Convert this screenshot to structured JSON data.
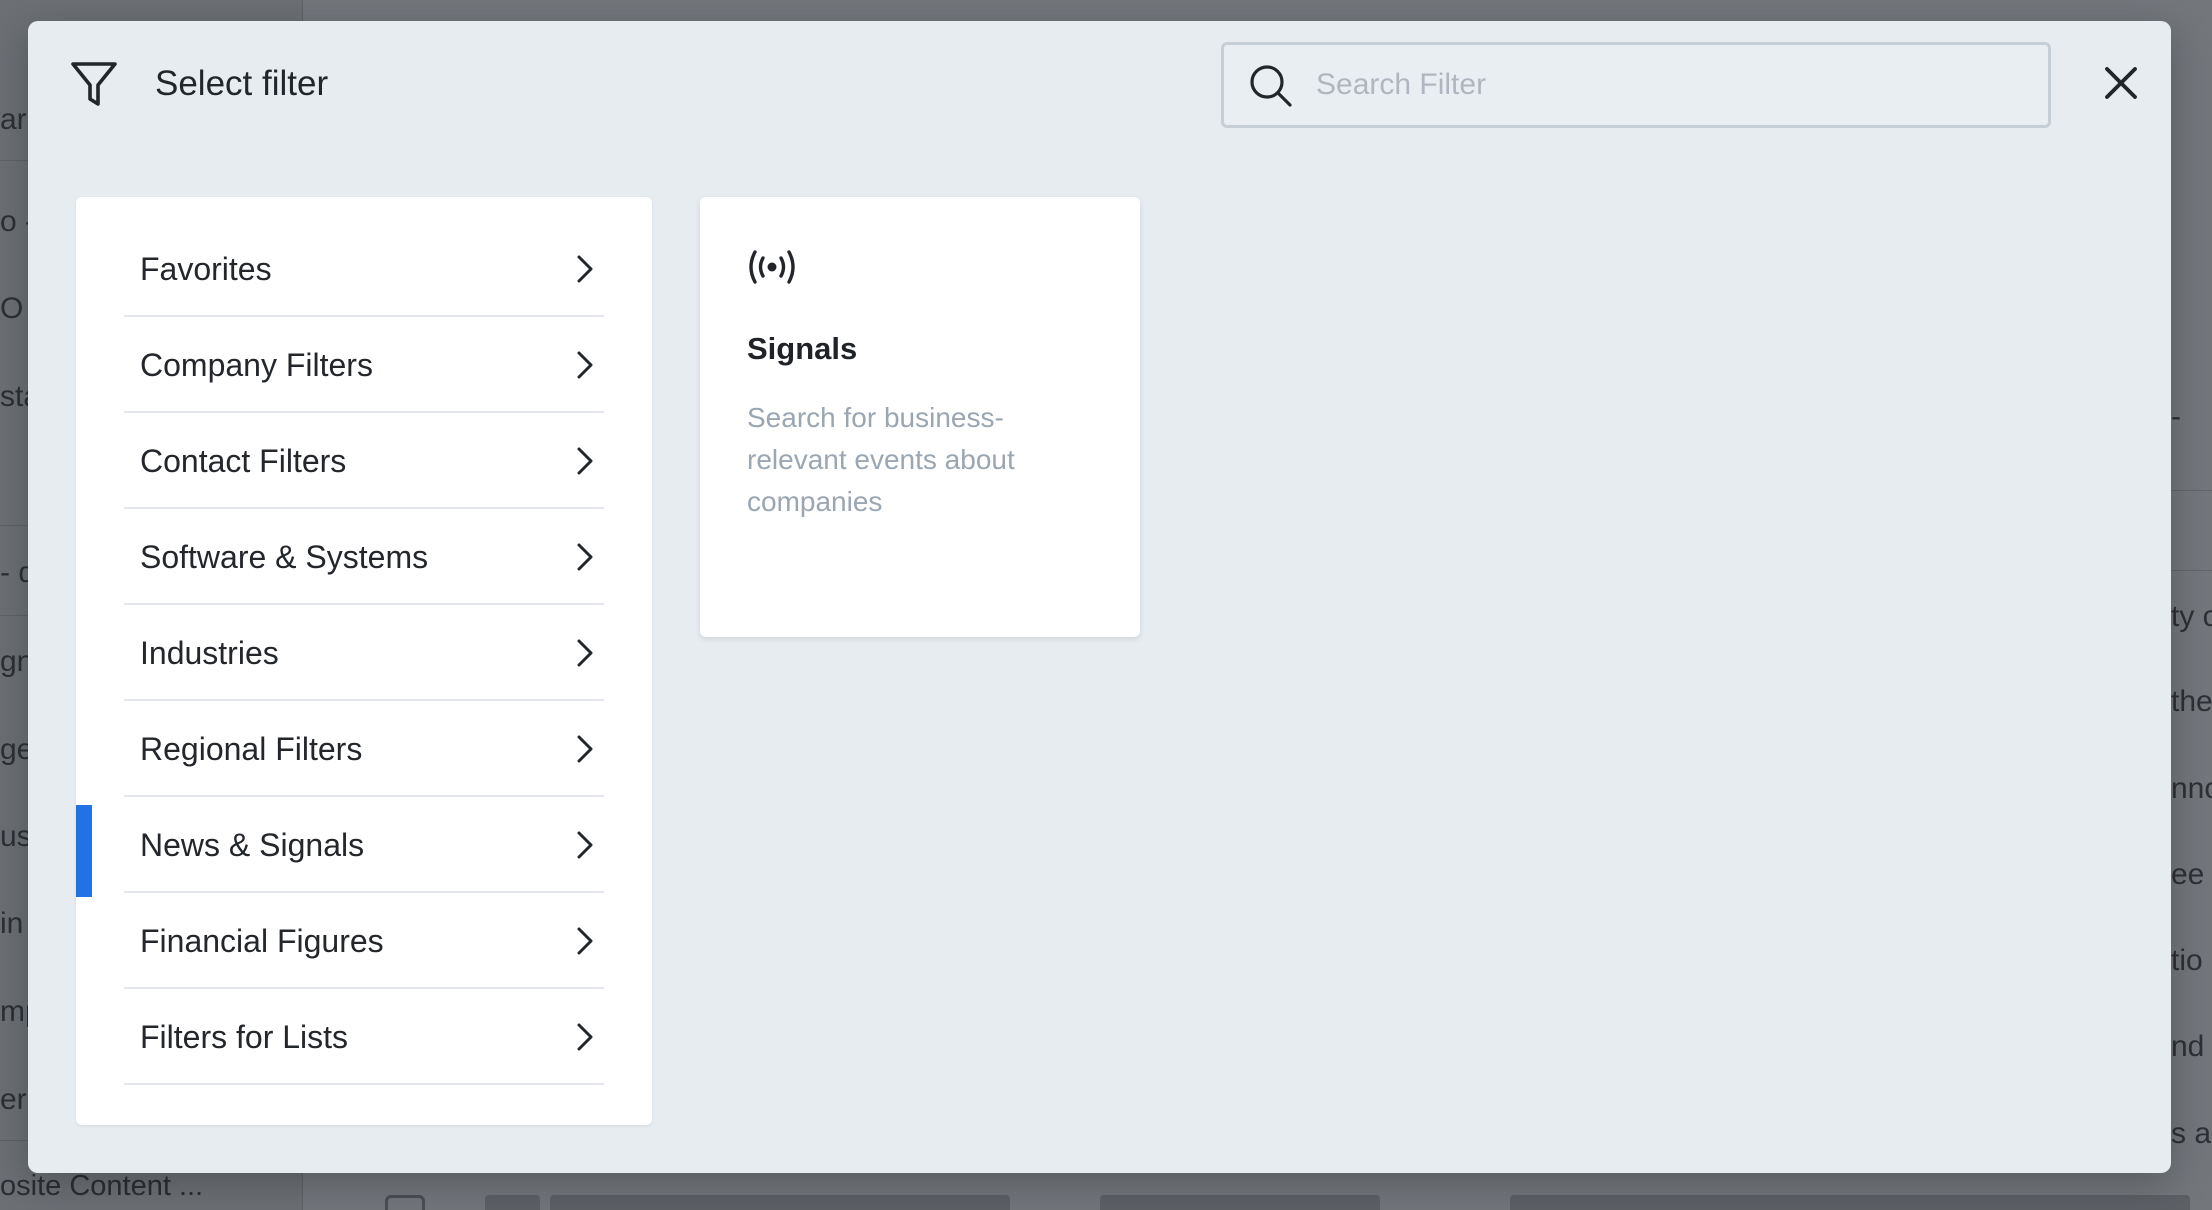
{
  "modal": {
    "title": "Select filter",
    "search_placeholder": "Search Filter",
    "search_value": ""
  },
  "categories": [
    {
      "label": "Favorites"
    },
    {
      "label": "Company Filters"
    },
    {
      "label": "Contact Filters"
    },
    {
      "label": "Software & Systems"
    },
    {
      "label": "Industries"
    },
    {
      "label": "Regional Filters"
    },
    {
      "label": "News & Signals",
      "active": true
    },
    {
      "label": "Financial Figures"
    },
    {
      "label": "Filters for Lists"
    }
  ],
  "signal_card": {
    "icon": "broadcast-icon",
    "title": "Signals",
    "description": "Search for business-relevant events about companies"
  },
  "background": {
    "sidebar_fragments": [
      "arc",
      "o -",
      "O (",
      "sta",
      "- d",
      "gna",
      "ge",
      "ust",
      "in",
      "mp",
      "er"
    ],
    "right_fragments": [
      "-",
      "ty c",
      "the",
      "nnc",
      "ee",
      "tio",
      "nd i",
      "s a"
    ],
    "bottom_label": "osite Content ..."
  },
  "colors": {
    "accent": "#2272e6",
    "modal_bg": "#e7ecf0",
    "text_primary": "#23272c",
    "text_muted": "#9aa6b2"
  }
}
